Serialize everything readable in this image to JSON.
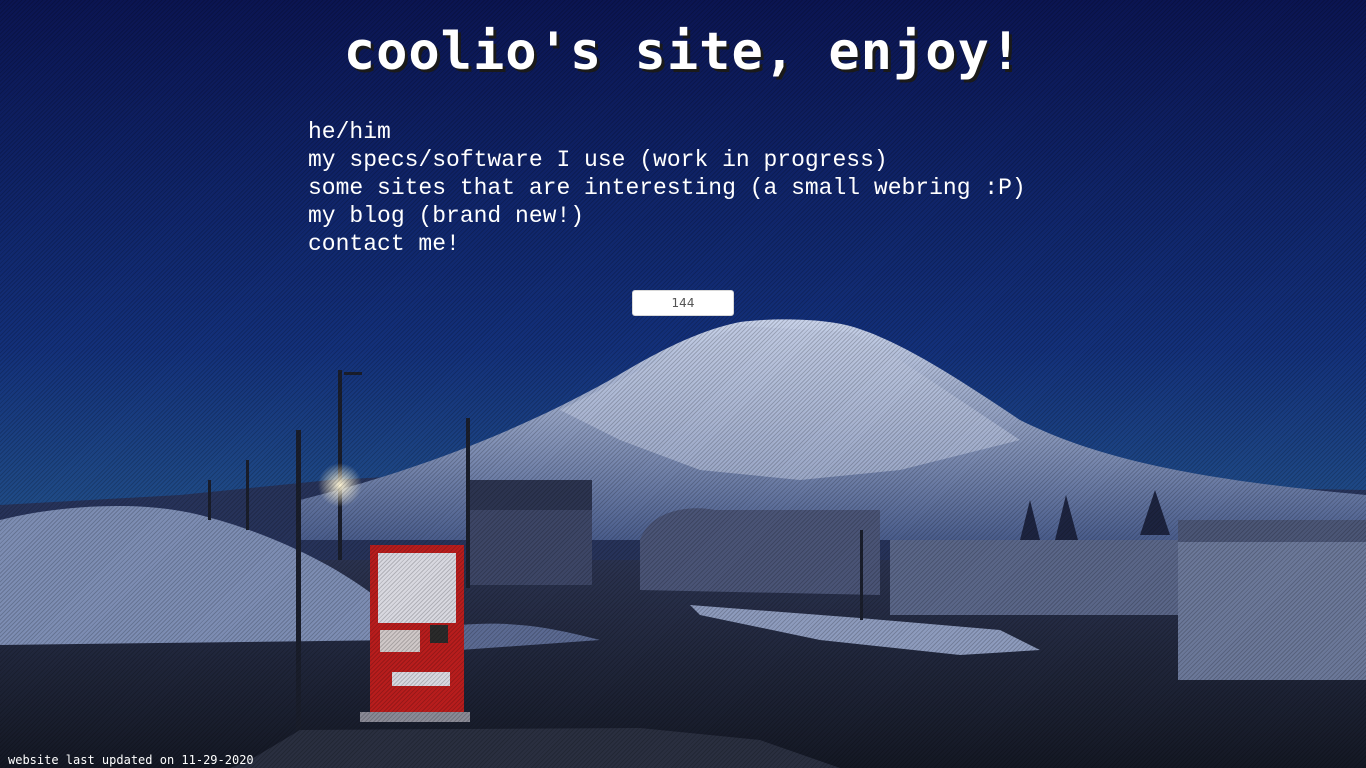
{
  "header": {
    "title": "coolio's site, enjoy!"
  },
  "nav": {
    "items": [
      {
        "label": "he/him"
      },
      {
        "label": "my specs/software I use (work in progress)"
      },
      {
        "label": "some sites that are interesting (a small webring :P)"
      },
      {
        "label": "my blog (brand new!)"
      },
      {
        "label": "contact me!"
      }
    ]
  },
  "counter": {
    "value": "144"
  },
  "footer": {
    "last_updated": "website last updated on 11-29-2020"
  },
  "background": {
    "description_icon": "mountain-night-photo",
    "sky_top": "#0b1552",
    "sky_bottom": "#1f4a86",
    "mountain": "#9aa7c8",
    "snow": "#c7d0e6",
    "ground": "#1a1f2e",
    "vending_machine": "#b81d1d"
  }
}
